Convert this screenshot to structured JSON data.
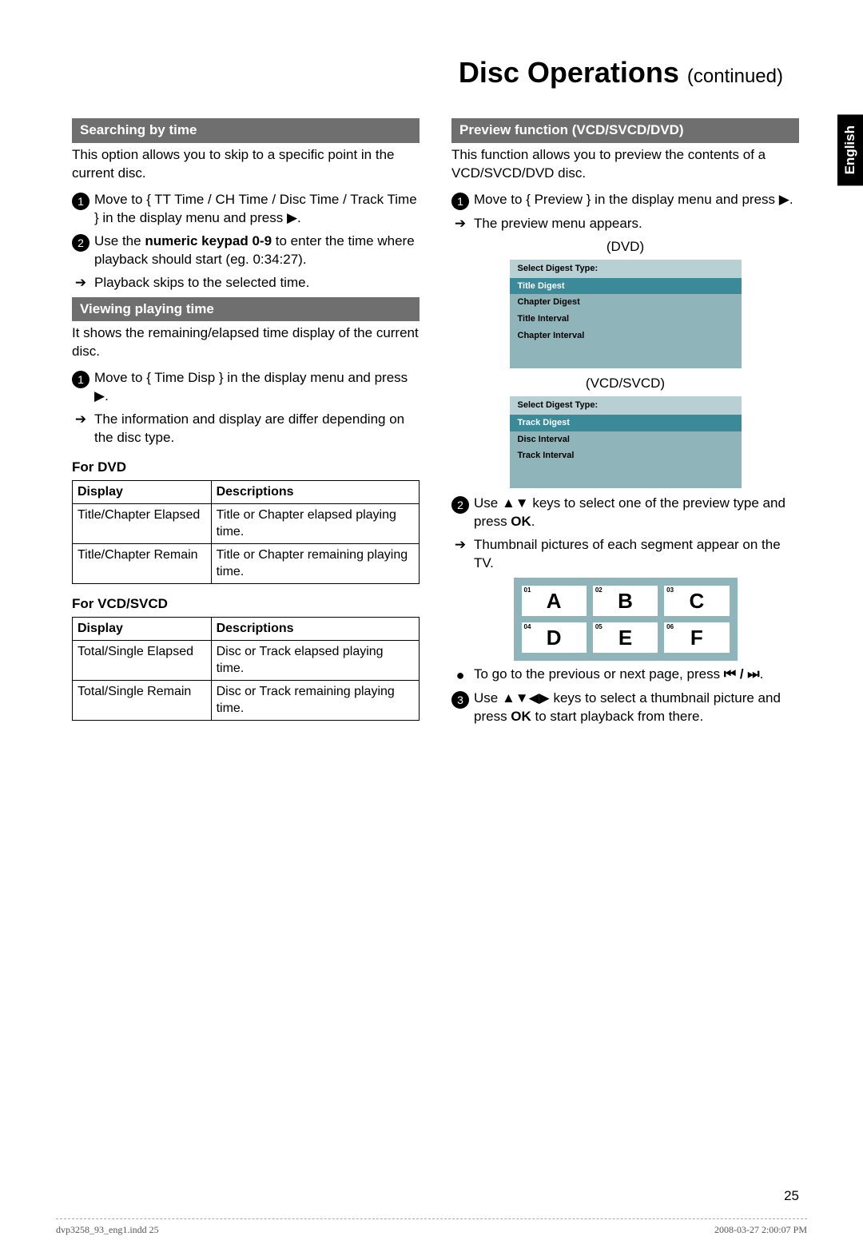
{
  "title_main": "Disc Operations ",
  "title_cont": "(continued)",
  "language_tab": "English",
  "page_number": "25",
  "footer_left": "dvp3258_93_eng1.indd   25",
  "footer_right": "2008-03-27   2:00:07 PM",
  "left": {
    "sec1_header": "Searching by time",
    "sec1_intro": "This option allows you to skip to a specific point in the current disc.",
    "sec1_step1": "Move to { TT Time / CH Time / Disc Time / Track Time } in the display menu and press ▶.",
    "sec1_step2_a": "Use the ",
    "sec1_step2_b": "numeric keypad 0-9",
    "sec1_step2_c": " to enter the time where playback should start (eg. 0:34:27).",
    "sec1_result": "Playback skips to the selected time.",
    "sec2_header": "Viewing playing time",
    "sec2_intro": "It shows the remaining/elapsed time display of the current disc.",
    "sec2_step1": "Move to { Time Disp } in the display menu and press ▶.",
    "sec2_result": "The information and display are differ depending on the disc type.",
    "dvd_label": "For DVD",
    "dvd_th1": "Display",
    "dvd_th2": "Descriptions",
    "dvd_r1c1": "Title/Chapter Elapsed",
    "dvd_r1c2": "Title or Chapter elapsed playing time.",
    "dvd_r2c1": "Title/Chapter Remain",
    "dvd_r2c2": "Title or Chapter remaining playing time.",
    "vcd_label": "For VCD/SVCD",
    "vcd_th1": "Display",
    "vcd_th2": "Descriptions",
    "vcd_r1c1": "Total/Single Elapsed",
    "vcd_r1c2": "Disc or Track elapsed playing time.",
    "vcd_r2c1": "Total/Single Remain",
    "vcd_r2c2": "Disc or Track remaining playing time."
  },
  "right": {
    "sec1_header": "Preview function (VCD/SVCD/DVD)",
    "sec1_intro": "This function allows you to preview the contents of a VCD/SVCD/DVD disc.",
    "step1": "Move to { Preview } in the display menu and press ▶.",
    "result1": "The preview menu appears.",
    "dvd_caption": "(DVD)",
    "dvd_menu_header": "Select Digest Type:",
    "dvd_menu_items": [
      "Title  Digest",
      "Chapter  Digest",
      "Title Interval",
      "Chapter Interval"
    ],
    "vcd_caption": "(VCD/SVCD)",
    "vcd_menu_header": "Select Digest Type:",
    "vcd_menu_items": [
      "Track  Digest",
      "Disc Interval",
      "Track Interval"
    ],
    "step2_a": "Use ▲▼ keys to select one of the preview type and press ",
    "step2_b": "OK",
    "step2_c": ".",
    "result2": "Thumbnail pictures of each segment appear on the TV.",
    "thumbs": [
      "A",
      "B",
      "C",
      "D",
      "E",
      "F"
    ],
    "thumb_nums": [
      "01",
      "02",
      "03",
      "04",
      "05",
      "06"
    ],
    "bullet1_a": "To go to the previous or next page, press ",
    "bullet1_b": "⏮ / ⏭",
    "bullet1_c": ".",
    "step3_a": "Use ▲▼◀▶ keys to select a thumbnail picture and press ",
    "step3_b": "OK",
    "step3_c": " to start playback from there."
  }
}
